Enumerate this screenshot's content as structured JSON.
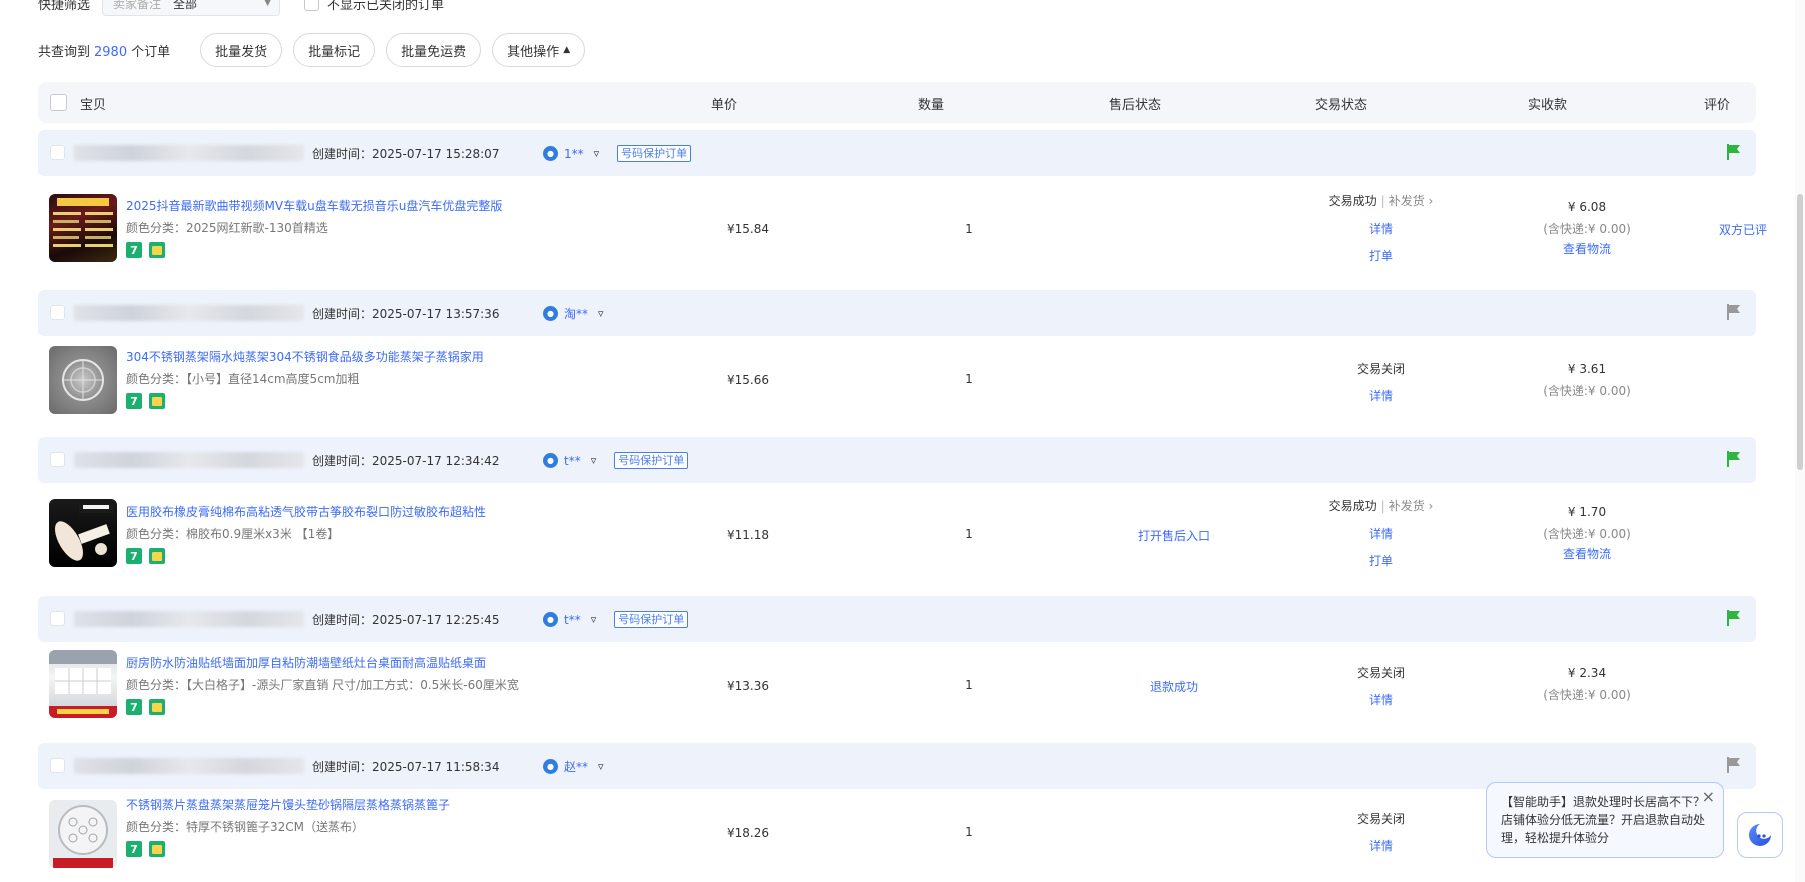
{
  "filter": {
    "label": "快捷筛选",
    "select_placeholder": "卖家备注",
    "select_value": "全部",
    "hide_closed_label": "不显示已关闭的订单"
  },
  "toolbar": {
    "count_prefix": "共查询到",
    "count": "2980",
    "count_suffix": "个订单",
    "buttons": [
      "批量发货",
      "批量标记",
      "批量免运费",
      "其他操作"
    ]
  },
  "table_header": {
    "item": "宝贝",
    "price": "单价",
    "qty": "数量",
    "after_sale": "售后状态",
    "trade": "交易状态",
    "paid": "实收款",
    "rating": "评价"
  },
  "orders": [
    {
      "created": "创建时间：2025-07-17 15:28:07",
      "buyer": "1**",
      "protect": "号码保护订单",
      "flag": "#2fb53f",
      "title": "2025抖音最新歌曲带视频MV车载u盘车载无损音乐u盘汽车优盘完整版",
      "sku": "颜色分类：2025网红新歌-130首精选",
      "price": "¥15.84",
      "qty": "1",
      "after_sale": "",
      "trade_status": "交易成功",
      "resend": "补发货",
      "detail": "详情",
      "print": "打单",
      "amount": "¥ 6.08",
      "shipping": "(含快递:¥ 0.00)",
      "logistics": "查看物流",
      "rating": "双方已评"
    },
    {
      "created": "创建时间：2025-07-17 13:57:36",
      "buyer": "淘**",
      "protect": "",
      "flag": "#999999",
      "title": "304不锈钢蒸架隔水炖蒸架304不锈钢食品级多功能蒸架子蒸锅家用",
      "sku": "颜色分类：【小号】直径14cm高度5cm加粗",
      "price": "¥15.66",
      "qty": "1",
      "after_sale": "",
      "trade_status": "交易关闭",
      "resend": "",
      "detail": "详情",
      "print": "",
      "amount": "¥ 3.61",
      "shipping": "(含快递:¥ 0.00)",
      "logistics": "",
      "rating": ""
    },
    {
      "created": "创建时间：2025-07-17 12:34:42",
      "buyer": "t**",
      "protect": "号码保护订单",
      "flag": "#2fb53f",
      "title": "医用胶布橡皮膏纯棉布高粘透气胶带古筝胶布裂口防过敏胶布超粘性",
      "sku": "颜色分类：棉胶布0.9厘米x3米 【1卷】",
      "price": "¥11.18",
      "qty": "1",
      "after_sale": "打开售后入口",
      "trade_status": "交易成功",
      "resend": "补发货",
      "detail": "详情",
      "print": "打单",
      "amount": "¥ 1.70",
      "shipping": "(含快递:¥ 0.00)",
      "logistics": "查看物流",
      "rating": ""
    },
    {
      "created": "创建时间：2025-07-17 12:25:45",
      "buyer": "t**",
      "protect": "号码保护订单",
      "flag": "#2fb53f",
      "title": "厨房防水防油贴纸墙面加厚自粘防潮墙壁纸灶台桌面耐高温贴纸桌面",
      "sku": "颜色分类：【大白格子】-源头厂家直销  尺寸/加工方式：0.5米长-60厘米宽",
      "price": "¥13.36",
      "qty": "1",
      "after_sale": "退款成功",
      "trade_status": "交易关闭",
      "resend": "",
      "detail": "详情",
      "print": "",
      "amount": "¥ 2.34",
      "shipping": "(含快递:¥ 0.00)",
      "logistics": "",
      "rating": ""
    },
    {
      "created": "创建时间：2025-07-17 11:58:34",
      "buyer": "赵**",
      "protect": "",
      "flag": "#999999",
      "title": "不锈钢蒸片蒸盘蒸架蒸屉笼片馒头垫砂锅隔层蒸格蒸锅蒸篦子",
      "sku": "颜色分类：特厚不锈钢篦子32CM（送蒸布）",
      "price": "¥18.26",
      "qty": "1",
      "after_sale": "",
      "trade_status": "交易关闭",
      "resend": "",
      "detail": "详情",
      "print": "",
      "amount": "",
      "shipping": "",
      "logistics": "",
      "rating": ""
    }
  ],
  "assistant": {
    "message": "【智能助手】退款处理时长居高不下？店铺体验分低无流量？开启退款自动处理，轻松提升体验分",
    "close": "×"
  }
}
